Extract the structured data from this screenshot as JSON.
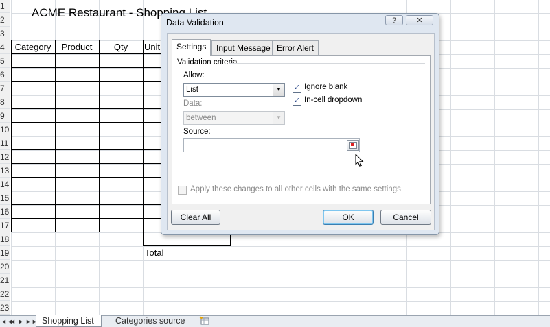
{
  "sheet": {
    "title": "ACME Restaurant - Shopping List",
    "row_numbers": [
      "1",
      "2",
      "3",
      "4",
      "5",
      "6",
      "7",
      "8",
      "9",
      "10",
      "11",
      "12",
      "13",
      "14",
      "15",
      "16",
      "17",
      "18",
      "19",
      "20",
      "21",
      "22",
      "23"
    ],
    "headers": [
      "Category",
      "Product",
      "Qty",
      "Unit"
    ],
    "total_label": "Total"
  },
  "tabs": {
    "nav": [
      "◄◄",
      "◄",
      "►",
      "►►"
    ],
    "sheets": [
      "Shopping List",
      "Categories source"
    ]
  },
  "dialog": {
    "title": "Data Validation",
    "help": "?",
    "close": "✕",
    "tabs": [
      "Settings",
      "Input Message",
      "Error Alert"
    ],
    "group_label": "Validation criteria",
    "allow_label": "Allow:",
    "allow_value": "List",
    "data_label": "Data:",
    "data_value": "between",
    "ignore_blank_label": "Ignore blank",
    "ignore_blank_checked": true,
    "in_cell_dropdown_label": "In-cell dropdown",
    "in_cell_dropdown_checked": true,
    "source_label": "Source:",
    "source_value": "",
    "apply_all_label": "Apply these changes to all other cells with the same settings",
    "apply_all_checked": false,
    "buttons": {
      "clear_all": "Clear All",
      "ok": "OK",
      "cancel": "Cancel"
    },
    "check_glyph": "✓"
  }
}
